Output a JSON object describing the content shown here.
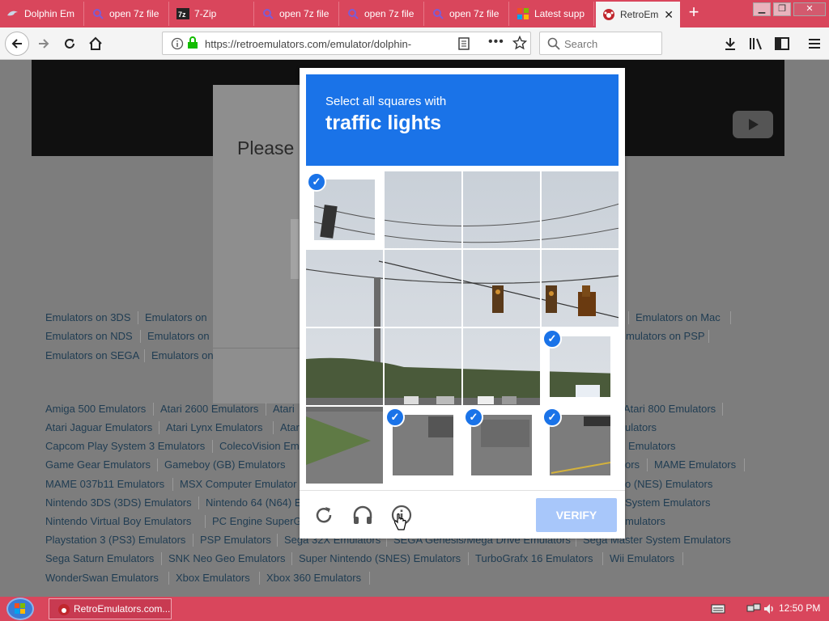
{
  "tabs": [
    {
      "label": "Dolphin Em",
      "icon": "dolphin-icon"
    },
    {
      "label": "open 7z file",
      "icon": "search-icon"
    },
    {
      "label": "7-Zip",
      "icon": "7zip-icon"
    },
    {
      "label": "open 7z file",
      "icon": "search-icon"
    },
    {
      "label": "open 7z file",
      "icon": "search-icon"
    },
    {
      "label": "open 7z file",
      "icon": "search-icon"
    },
    {
      "label": "Latest supp",
      "icon": "windows-icon"
    },
    {
      "label": "RetroEm",
      "icon": "retroemulators-icon",
      "active": true
    }
  ],
  "nav": {
    "url": "https://retroemulators.com/emulator/dolphin-",
    "search_placeholder": "Search"
  },
  "page": {
    "modal_text": "Please t",
    "links": [
      {
        "text": "Emulators on 3DS"
      },
      {
        "text": "Emulators on"
      },
      {
        "text": "Emulators on Mac"
      },
      {
        "text": "Emulators on NDS"
      },
      {
        "text": "Emulators on"
      },
      {
        "text": "mulators on PSP"
      },
      {
        "text": "Emulators on SEGA"
      },
      {
        "text": "Emulators on"
      },
      {
        "text": "Amiga 500 Emulators"
      },
      {
        "text": "Atari 2600 Emulators"
      },
      {
        "text": "Atari"
      },
      {
        "text": "Atari 800 Emulators"
      },
      {
        "text": "Atari Jaguar Emulators"
      },
      {
        "text": "Atari Lynx Emulators"
      },
      {
        "text": "Atar"
      },
      {
        "text": "ulators"
      },
      {
        "text": "Capcom Play System 3 Emulators"
      },
      {
        "text": "ColecoVision Em"
      },
      {
        "text": "Emulators"
      },
      {
        "text": "Game Gear Emulators"
      },
      {
        "text": "Gameboy (GB) Emulators"
      },
      {
        "text": "ors"
      },
      {
        "text": "MAME Emulators"
      },
      {
        "text": "MAME 037b11 Emulators"
      },
      {
        "text": "MSX Computer Emulator"
      },
      {
        "text": "o (NES) Emulators"
      },
      {
        "text": "Nintendo 3DS (3DS) Emulators"
      },
      {
        "text": "Nintendo 64 (N64) E"
      },
      {
        "text": "System Emulators"
      },
      {
        "text": "Nintendo Virtual Boy Emulators"
      },
      {
        "text": "PC Engine SuperG"
      },
      {
        "text": "mulators"
      },
      {
        "text": "Playstation 3 (PS3) Emulators"
      },
      {
        "text": "PSP Emulators"
      },
      {
        "text": "Sega 32X Emulators"
      },
      {
        "text": "SEGA Genesis/Mega Drive Emulators"
      },
      {
        "text": "Sega Master System Emulators"
      },
      {
        "text": "Sega Saturn Emulators"
      },
      {
        "text": "SNK Neo Geo Emulators"
      },
      {
        "text": "Super Nintendo (SNES) Emulators"
      },
      {
        "text": "TurboGrafx 16 Emulators"
      },
      {
        "text": "Wii Emulators"
      },
      {
        "text": "WonderSwan Emulators"
      },
      {
        "text": "Xbox Emulators"
      },
      {
        "text": "Xbox 360 Emulators"
      }
    ]
  },
  "captcha": {
    "line1": "Select all squares with",
    "line2": "traffic lights",
    "verify_label": "VERIFY",
    "selected_cells": [
      0,
      11,
      13,
      14,
      15
    ],
    "accent": "#1a73e8"
  },
  "taskbar": {
    "item_label": "RetroEmulators.com...",
    "clock": "12:50 PM"
  },
  "colors": {
    "chrome_red": "#d9465c",
    "captcha_blue": "#1a73e8",
    "verify_disabled": "#a8c7fa"
  }
}
